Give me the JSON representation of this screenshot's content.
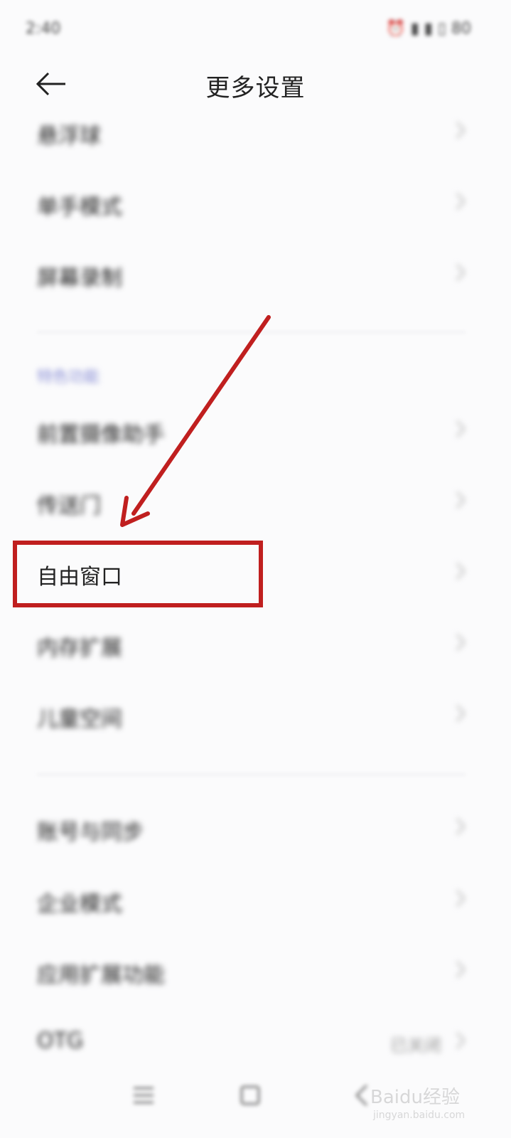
{
  "status_bar": {
    "time": "2:40",
    "icons": "⏰ ▮ ▮ ▯ 80"
  },
  "header": {
    "title": "更多设置"
  },
  "items_top": [
    {
      "label": "悬浮球"
    },
    {
      "label": "单手模式"
    },
    {
      "label": "屏幕录制"
    }
  ],
  "section": {
    "label": "特色功能"
  },
  "items_feature": [
    {
      "label": "前置摄像助手"
    },
    {
      "label": "传送门"
    },
    {
      "label": "自由窗口"
    },
    {
      "label": "内存扩展"
    },
    {
      "label": "儿童空间"
    }
  ],
  "items_bottom": [
    {
      "label": "账号与同步"
    },
    {
      "label": "企业模式"
    },
    {
      "label": "应用扩展功能"
    },
    {
      "label": "OTG",
      "value": "已关闭"
    }
  ],
  "watermark": {
    "logo": "Baidu经验",
    "sub": "jingyan.baidu.com"
  },
  "colors": {
    "highlight": "#c01f1f",
    "section_accent": "#8a8fd6"
  }
}
